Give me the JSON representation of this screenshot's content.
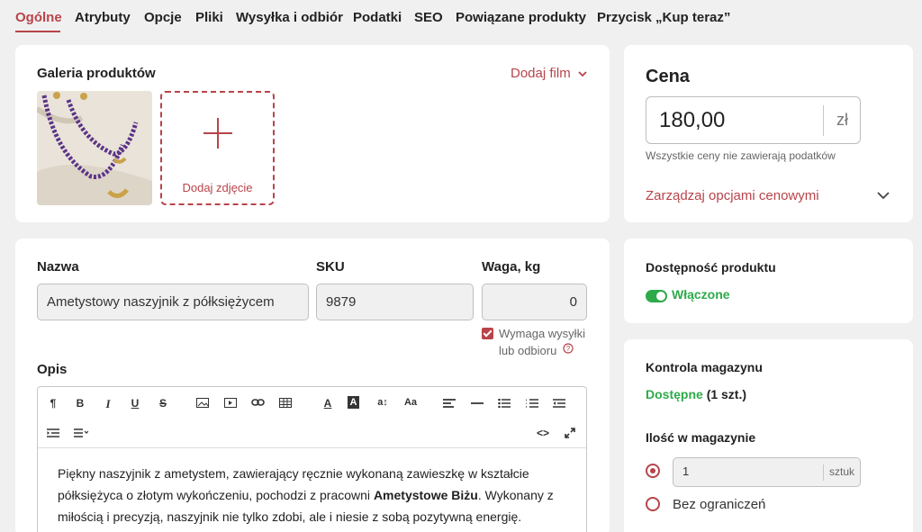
{
  "tabs": [
    "Ogólne",
    "Atrybuty",
    "Opcje",
    "Pliki",
    "Wysyłka i odbiór",
    "Podatki",
    "SEO",
    "Powiązane produkty",
    "Przycisk „Kup teraz”"
  ],
  "gallery": {
    "title": "Galeria produktów",
    "add_video": "Dodaj film",
    "add_photo": "Dodaj zdjęcie"
  },
  "price": {
    "title": "Cena",
    "value": "180,00",
    "currency": "zł",
    "note": "Wszystkie ceny nie zawierają podatków",
    "manage": "Zarządzaj opcjami cenowymi"
  },
  "details": {
    "name_label": "Nazwa",
    "name_value": "Ametystowy naszyjnik z półksiężycem",
    "sku_label": "SKU",
    "sku_value": "9879",
    "weight_label": "Waga, kg",
    "weight_value": "0",
    "shipping_line1": "Wymaga wysyłki",
    "shipping_line2": "lub odbioru",
    "desc_label": "Opis",
    "desc_part1": "Piękny naszyjnik z ametystem, zawierający ręcznie wykonaną zawieszkę w kształcie półksiężyca o złotym wykończeniu, pochodzi z pracowni ",
    "desc_bold": "Ametystowe Biżu",
    "desc_part2": ". Wykonany z miłością i precyzją, naszyjnik nie tylko zdobi, ale i niesie z sobą pozytywną energię."
  },
  "toolbar_glyphs": {
    "paragraph": "¶",
    "bold": "B",
    "italic": "I",
    "underline": "U",
    "strike": "S",
    "font_color": "A",
    "bg_color": "A",
    "font_size": "a↕",
    "case": "Aa",
    "code": "<>"
  },
  "availability": {
    "title": "Dostępność produktu",
    "state": "Włączone"
  },
  "inventory": {
    "title": "Kontrola magazynu",
    "status": "Dostępne",
    "count": "(1 szt.)",
    "qty_title": "Ilość w magazynie",
    "qty_value": "1",
    "qty_unit": "sztuk",
    "unlimited": "Bez ograniczeń"
  },
  "colors": {
    "accent": "#b8444a",
    "success": "#2eaa4a"
  }
}
